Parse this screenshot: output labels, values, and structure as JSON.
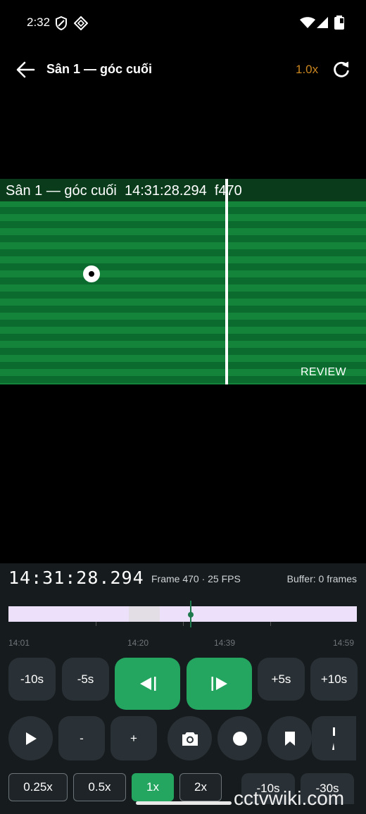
{
  "status_bar": {
    "time": "2:32",
    "icons": [
      "shield-icon",
      "diamond-grid-icon",
      "wifi-icon",
      "signal-icon",
      "battery-icon"
    ]
  },
  "app_bar": {
    "title": "Sân 1 — góc cuối",
    "speed": "1.0x",
    "speed_color": "#c9861f"
  },
  "video": {
    "overlay_text": "Sân 1 — góc cuối  14:31:28.294  f470",
    "review_label": "REVIEW"
  },
  "panel": {
    "timecode": "14:31:28.294",
    "frame_info": "Frame 470 · 25 FPS",
    "buffer_info": "Buffer: 0 frames",
    "timeline_labels": [
      "14:01",
      "14:20",
      "14:39",
      "14:59"
    ],
    "transport": {
      "back10": "-10s",
      "back5": "-5s",
      "fwd5": "+5s",
      "fwd10": "+10s",
      "minus": "-",
      "plus": "+"
    },
    "speeds": [
      "0.25x",
      "0.5x",
      "1x",
      "2x"
    ],
    "active_speed": "1x",
    "jumps": [
      "-10s",
      "-30s"
    ],
    "accent_color": "#24a560"
  },
  "watermark": "cctvwiki.com"
}
